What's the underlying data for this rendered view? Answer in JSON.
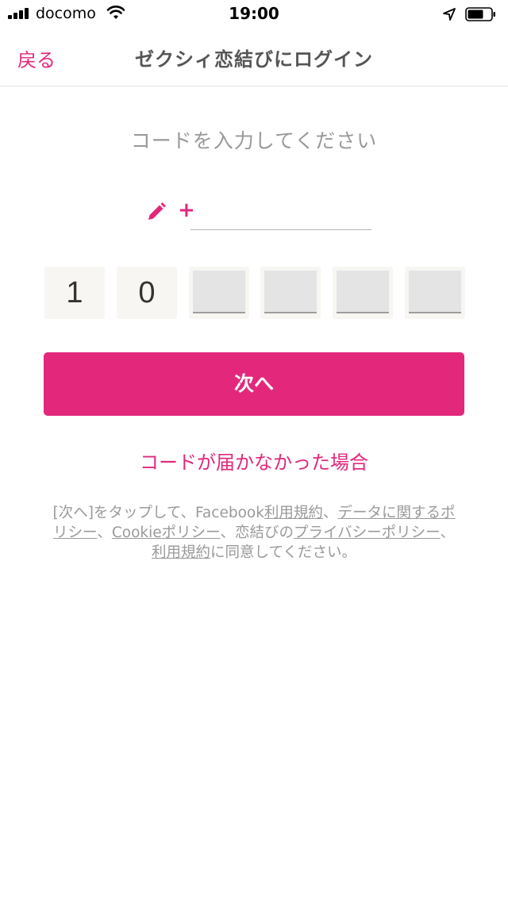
{
  "status_bar": {
    "carrier": "docomo",
    "time": "19:00",
    "icons": [
      "signal-icon",
      "wifi-icon",
      "location-arrow-icon",
      "battery-icon"
    ]
  },
  "nav": {
    "back_label": "戻る",
    "title": "ゼクシィ恋結びにログイン"
  },
  "main": {
    "instruction": "コードを入力してください",
    "phone_prefix": "+",
    "phone_value": "",
    "code_digits": [
      "1",
      "0",
      "",
      "",
      "",
      ""
    ],
    "next_label": "次へ",
    "no_code_link": "コードが届かなかった場合"
  },
  "terms": {
    "part1": "[次へ]をタップして、Facebook",
    "link_fb_terms": "利用規約",
    "part2": "、",
    "link_data_policy": "データに関するポリシー",
    "part3": "、",
    "link_cookie_policy": "Cookieポリシー",
    "part4": "、恋結びの",
    "link_privacy_policy": "プライバシーポリシー",
    "part5": "、",
    "link_terms": "利用規約",
    "part6": "に同意してください。"
  },
  "colors": {
    "accent": "#e3287c",
    "text_gray": "#999999",
    "box_bg": "#f7f6f2",
    "box_empty": "#e4e4e4"
  }
}
